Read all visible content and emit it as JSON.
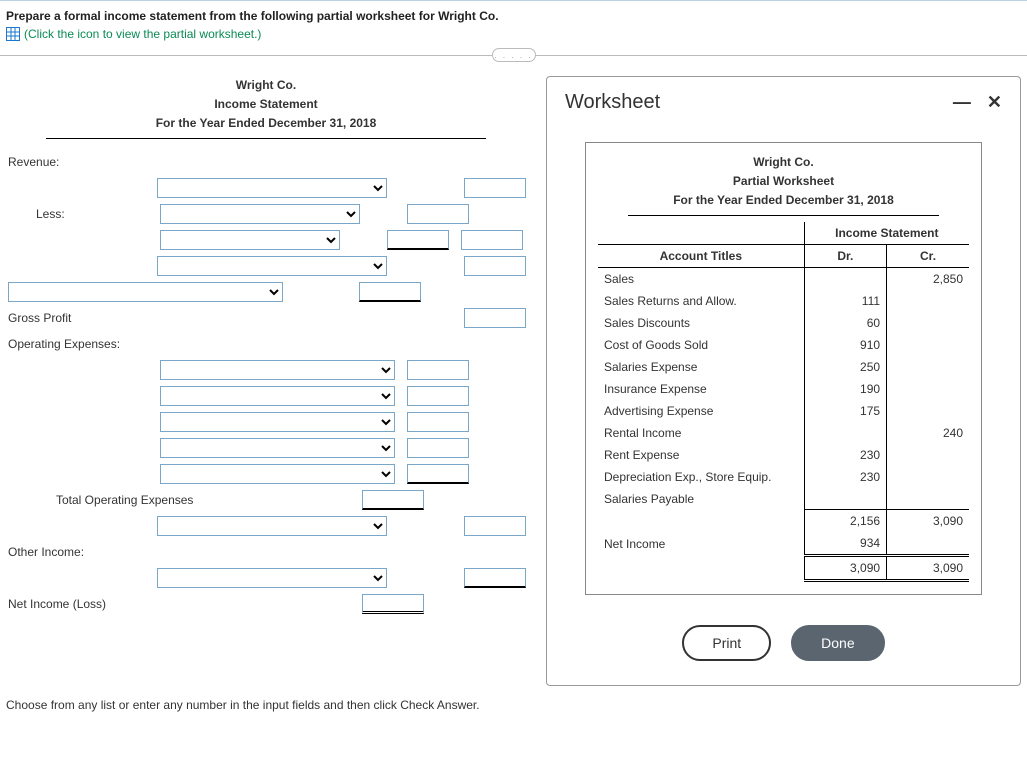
{
  "instruction": "Prepare a formal income statement from the following partial worksheet for Wright Co.",
  "link_text": "(Click the icon to view the partial worksheet.)",
  "tab_dots": ". . . . .",
  "statement": {
    "company": "Wright Co.",
    "title": "Income Statement",
    "period": "For the Year Ended December 31, 2018",
    "labels": {
      "revenue": "Revenue:",
      "less": "Less:",
      "gross_profit": "Gross Profit",
      "operating_expenses": "Operating Expenses:",
      "total_operating_expenses": "Total Operating Expenses",
      "other_income": "Other Income:",
      "net_income": "Net Income (Loss)"
    }
  },
  "modal": {
    "title": "Worksheet",
    "minimize": "—",
    "close": "✕",
    "print": "Print",
    "done": "Done"
  },
  "worksheet": {
    "company": "Wright Co.",
    "subtitle": "Partial Worksheet",
    "period": "For the Year Ended December 31, 2018",
    "col_group": "Income Statement",
    "col_account": "Account Titles",
    "col_dr": "Dr.",
    "col_cr": "Cr.",
    "rows": [
      {
        "title": "Sales",
        "dr": "",
        "cr": "2,850"
      },
      {
        "title": "Sales Returns and Allow.",
        "dr": "111",
        "cr": ""
      },
      {
        "title": "Sales Discounts",
        "dr": "60",
        "cr": ""
      },
      {
        "title": "Cost of Goods Sold",
        "dr": "910",
        "cr": ""
      },
      {
        "title": "Salaries Expense",
        "dr": "250",
        "cr": ""
      },
      {
        "title": "Insurance Expense",
        "dr": "190",
        "cr": ""
      },
      {
        "title": "Advertising Expense",
        "dr": "175",
        "cr": ""
      },
      {
        "title": "Rental Income",
        "dr": "",
        "cr": "240"
      },
      {
        "title": "Rent Expense",
        "dr": "230",
        "cr": ""
      },
      {
        "title": "Depreciation Exp., Store Equip.",
        "dr": "230",
        "cr": ""
      },
      {
        "title": "Salaries Payable",
        "dr": "",
        "cr": ""
      }
    ],
    "subtotal": {
      "title": "",
      "dr": "2,156",
      "cr": "3,090"
    },
    "netincome": {
      "title": "Net Income",
      "dr": "934",
      "cr": ""
    },
    "total": {
      "title": "",
      "dr": "3,090",
      "cr": "3,090"
    }
  },
  "footer": "Choose from any list or enter any number in the input fields and then click Check Answer."
}
